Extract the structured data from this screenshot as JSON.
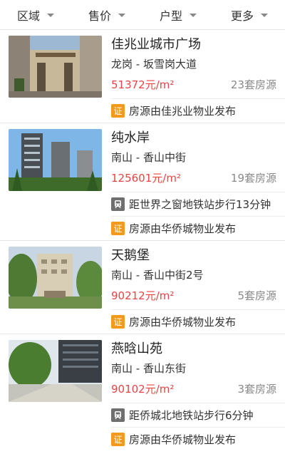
{
  "filters": [
    {
      "label": "区域"
    },
    {
      "label": "售价"
    },
    {
      "label": "户型"
    },
    {
      "label": "更多"
    }
  ],
  "badge_text": "证",
  "listings": [
    {
      "name": "佳兆业城市广场",
      "location": "龙岗 - 坂雪岗大道",
      "price": "51372元/m²",
      "count": "23套房源",
      "metro": "",
      "publisher": "房源由佳兆业物业发布"
    },
    {
      "name": "纯水岸",
      "location": "南山 - 香山中街",
      "price": "125601元/m²",
      "count": "19套房源",
      "metro": "距世界之窗地铁站步行13分钟",
      "publisher": "房源由华侨城物业发布"
    },
    {
      "name": "天鹅堡",
      "location": "南山 - 香山中街2号",
      "price": "90212元/m²",
      "count": "5套房源",
      "metro": "",
      "publisher": "房源由华侨城物业发布"
    },
    {
      "name": "燕晗山苑",
      "location": "南山 - 香山东街",
      "price": "90102元/m²",
      "count": "3套房源",
      "metro": "距侨城北地铁站步行6分钟",
      "publisher": "房源由华侨城物业发布"
    }
  ],
  "colors": {
    "price": "#e94444",
    "badge_cert": "#f39a1c",
    "badge_metro": "#6f6f6f"
  },
  "icons": {
    "cert": "certificate-badge-icon",
    "metro": "metro-train-icon",
    "filter_caret": "chevron-down-icon"
  }
}
